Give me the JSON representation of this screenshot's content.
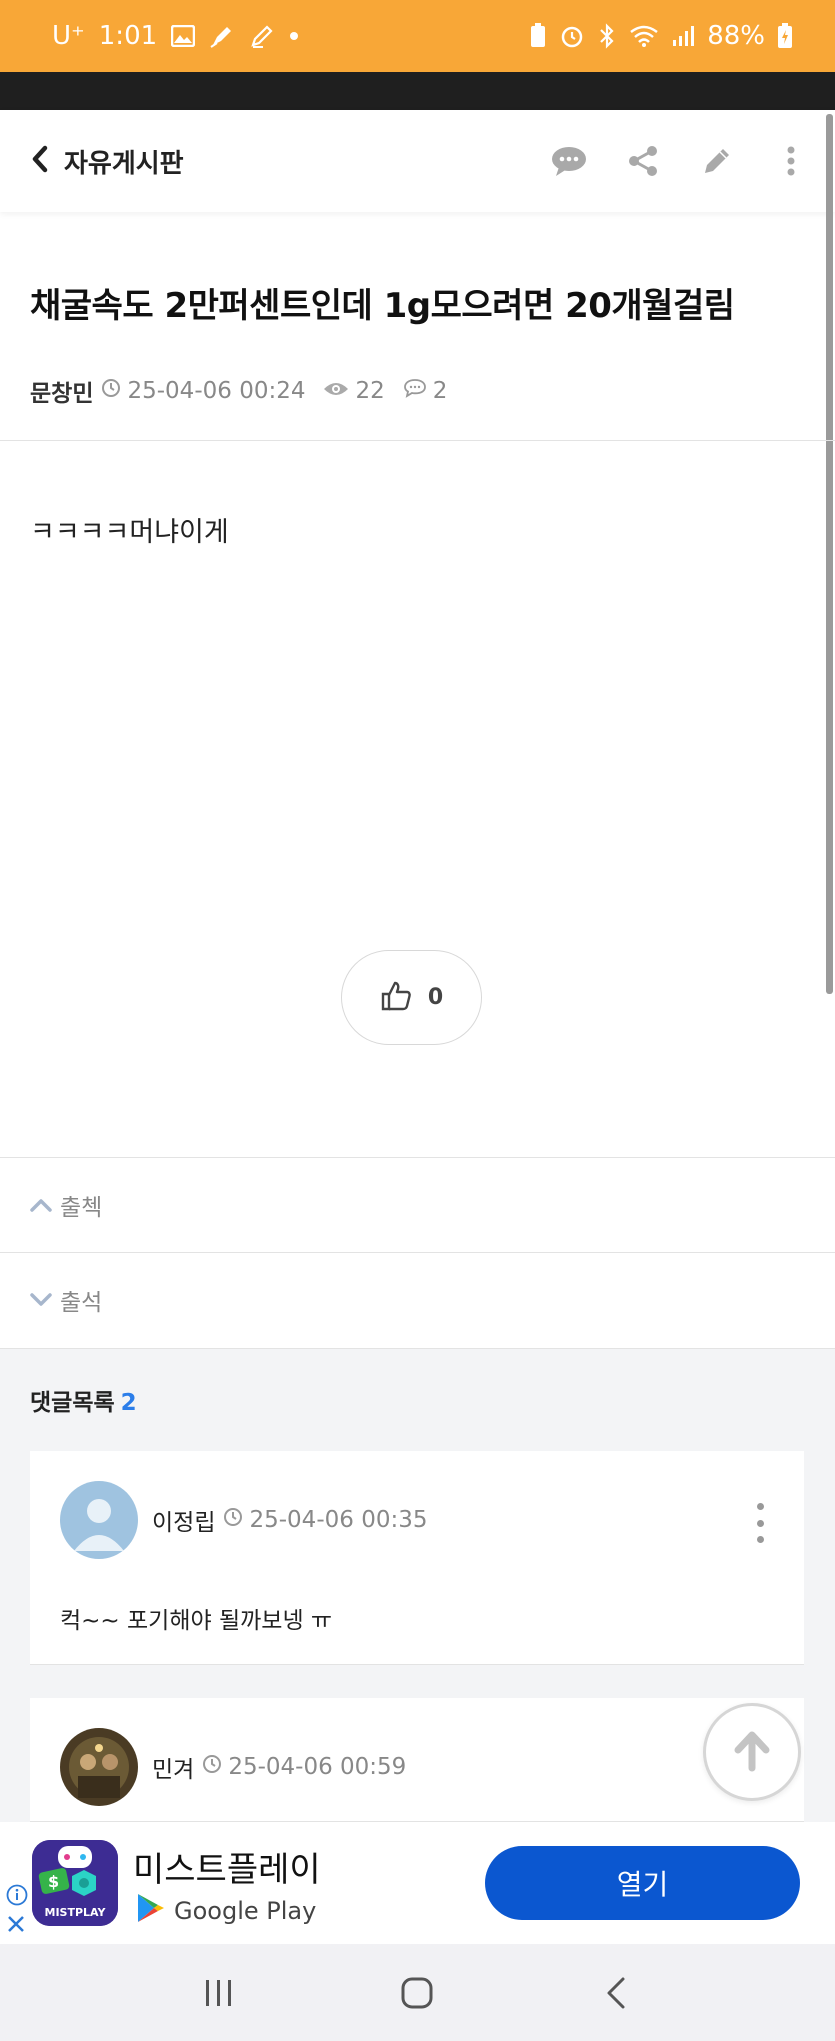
{
  "status_bar": {
    "carrier": "U⁺",
    "time": "1:01",
    "battery": "88%"
  },
  "header": {
    "title": "자유게시판"
  },
  "post": {
    "title": "채굴속도 2만퍼센트인데 1g모으려면 20개월걸림",
    "author": "문창민",
    "date": "25-04-06 00:24",
    "views": "22",
    "comments": "2",
    "body": "ㅋㅋㅋㅋ머냐이게",
    "likes": "0"
  },
  "navigation": {
    "prev_label": "출첵",
    "next_label": "출석"
  },
  "comments_section": {
    "title": "댓글목록",
    "count": "2",
    "items": [
      {
        "author": "이정립",
        "date": "25-04-06 00:35",
        "text": "컥~~  포기해야 될까보넹 ㅠ"
      },
      {
        "author": "민겨",
        "date": "25-04-06 00:59"
      }
    ]
  },
  "ad": {
    "app_name": "미스트플레이",
    "store": "Google Play",
    "icon_text": "MISTPLAY",
    "open_label": "열기"
  },
  "colors": {
    "status_bar": "#f8a737",
    "accent_blue": "#2b7de9",
    "ad_button": "#0b57d0"
  }
}
